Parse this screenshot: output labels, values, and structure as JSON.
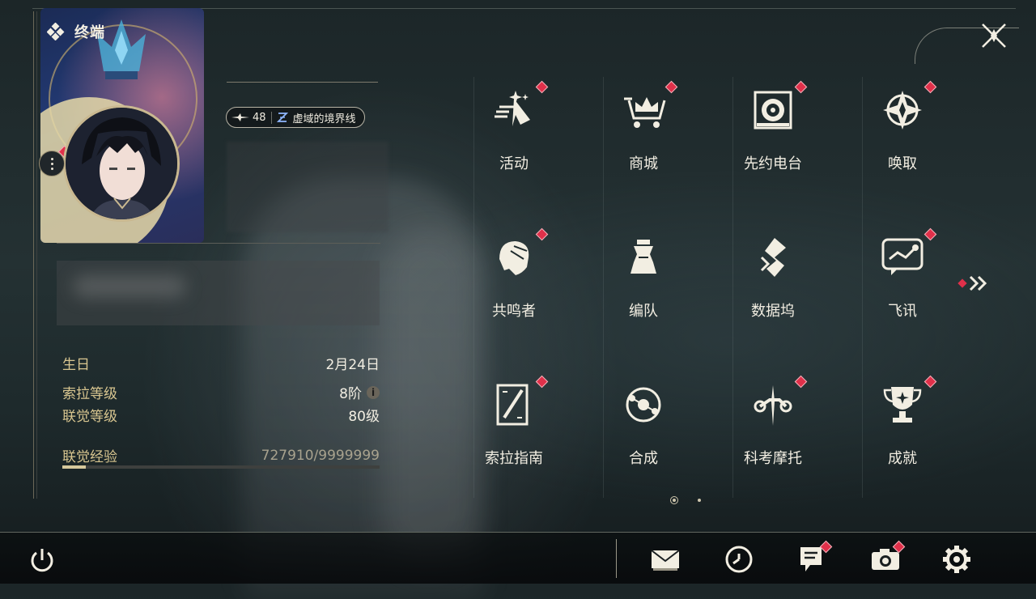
{
  "header": {
    "title": "终端"
  },
  "profile": {
    "level": "48",
    "title_badge": "虚域的境界线"
  },
  "info": {
    "birthday_label": "生日",
    "birthday_value": "2月24日",
    "sola_level_label": "索拉等级",
    "sola_level_value": "8阶",
    "union_level_label": "联觉等级",
    "union_level_value": "80级",
    "union_exp_label": "联觉经验",
    "union_exp_value": "727910/9999999",
    "union_exp_progress": 0.0728
  },
  "menu": [
    {
      "label": "活动",
      "icon": "sparkle-icon",
      "badge": true
    },
    {
      "label": "商城",
      "icon": "cart-icon",
      "badge": true
    },
    {
      "label": "先约电台",
      "icon": "radio-icon",
      "badge": true
    },
    {
      "label": "唤取",
      "icon": "compass-star-icon",
      "badge": true
    },
    {
      "label": "共鸣者",
      "icon": "character-icon",
      "badge": true
    },
    {
      "label": "编队",
      "icon": "chess-icon",
      "badge": false
    },
    {
      "label": "数据坞",
      "icon": "data-dock-icon",
      "badge": false
    },
    {
      "label": "飞讯",
      "icon": "message-icon",
      "badge": true
    },
    {
      "label": "索拉指南",
      "icon": "guide-book-icon",
      "badge": true
    },
    {
      "label": "合成",
      "icon": "synthesis-icon",
      "badge": false
    },
    {
      "label": "科考摩托",
      "icon": "motorbike-icon",
      "badge": true
    },
    {
      "label": "成就",
      "icon": "trophy-icon",
      "badge": true
    }
  ],
  "pager": {
    "current": 1,
    "total": 2
  },
  "colors": {
    "accent_gold": "#d9c690",
    "badge_red": "#e0304a",
    "text": "#f2eee2"
  }
}
